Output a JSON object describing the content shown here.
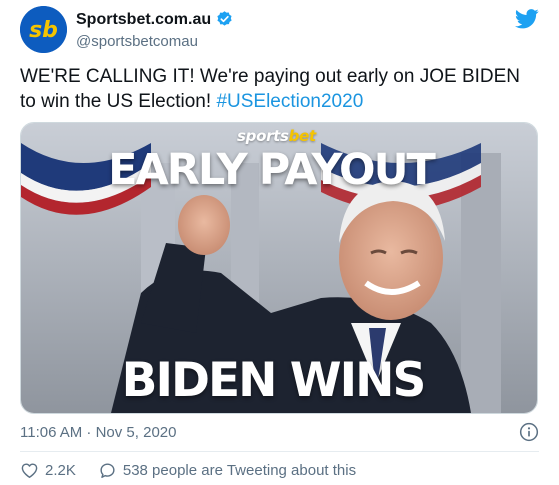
{
  "author": {
    "display_name": "Sportsbet.com.au",
    "handle": "@sportsbetcomau",
    "avatar_text": "sb"
  },
  "tweet": {
    "text": "WE'RE CALLING IT! We're paying out early on JOE BIDEN to win the US Election! ",
    "hashtag": "#USElection2020",
    "timestamp": "11:06 AM · Nov 5, 2020"
  },
  "media": {
    "brand_main": "sports",
    "brand_accent": "bet",
    "headline_top": "EARLY PAYOUT",
    "headline_bottom": "BIDEN WINS"
  },
  "actions": {
    "likes": "2.2K",
    "conversation": "538 people are Tweeting about this"
  },
  "icons": {
    "verified": "verified-badge-icon",
    "platform": "twitter-bird-icon",
    "info": "info-icon",
    "like": "heart-icon",
    "reply": "speech-bubble-icon"
  },
  "colors": {
    "accent": "#1b95e0",
    "text_secondary": "#5b7083",
    "brand_blue": "#0d5cbf",
    "brand_yellow": "#f5c400"
  }
}
